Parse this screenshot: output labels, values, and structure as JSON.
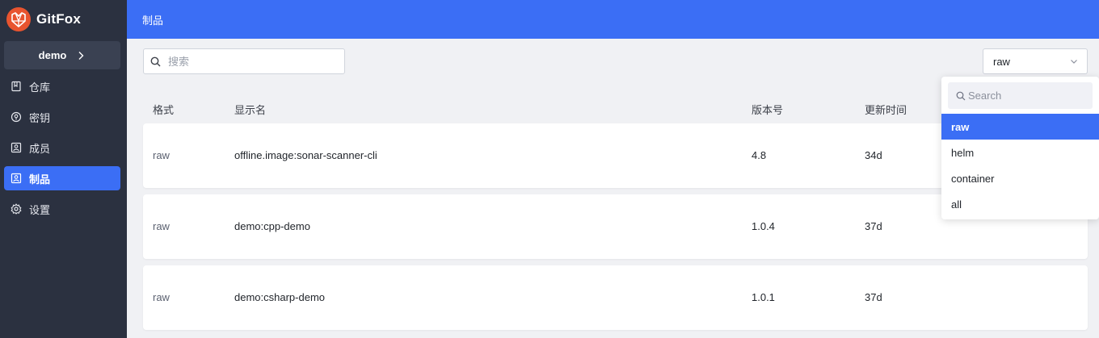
{
  "brand": {
    "name": "GitFox",
    "logo_icon": "fox-logo-icon",
    "accent": "#3b6ef5",
    "sidebar_bg": "#2b3140"
  },
  "project": {
    "name": "demo",
    "icon": "chevron-right-icon"
  },
  "sidebar": {
    "items": [
      {
        "label": "仓库",
        "icon": "repo-icon",
        "active": false
      },
      {
        "label": "密钥",
        "icon": "secret-icon",
        "active": false
      },
      {
        "label": "成员",
        "icon": "member-icon",
        "active": false
      },
      {
        "label": "制品",
        "icon": "artifact-icon",
        "active": true
      },
      {
        "label": "设置",
        "icon": "gear-icon",
        "active": false
      }
    ]
  },
  "header": {
    "title": "制品"
  },
  "toolbar": {
    "search_placeholder": "搜索",
    "search_value": "",
    "format_selected": "raw"
  },
  "table": {
    "columns": [
      "格式",
      "显示名",
      "版本号",
      "更新时间"
    ],
    "rows": [
      {
        "format": "raw",
        "name": "offline.image:sonar-scanner-cli",
        "version": "4.8",
        "updated": "34d"
      },
      {
        "format": "raw",
        "name": "demo:cpp-demo",
        "version": "1.0.4",
        "updated": "37d"
      },
      {
        "format": "raw",
        "name": "demo:csharp-demo",
        "version": "1.0.1",
        "updated": "37d"
      }
    ]
  },
  "dropdown": {
    "search_placeholder": "Search",
    "options": [
      "raw",
      "helm",
      "container",
      "all"
    ],
    "selected": "raw"
  }
}
